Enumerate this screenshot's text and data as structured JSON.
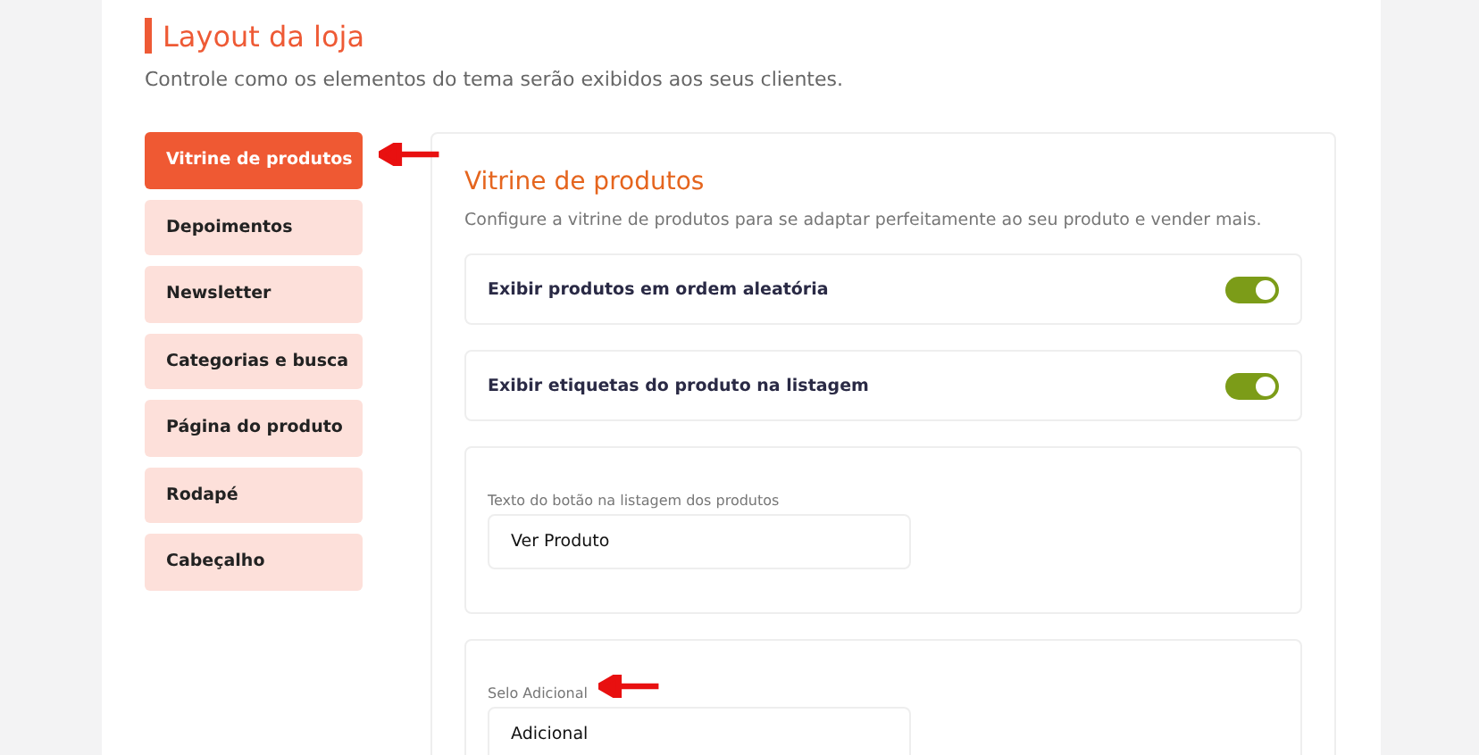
{
  "header": {
    "title": "Layout da loja",
    "subtitle": "Controle como os elementos do tema serão exibidos aos seus clientes."
  },
  "sidebar": {
    "items": [
      {
        "label": "Vitrine de produtos",
        "selected": true
      },
      {
        "label": "Depoimentos",
        "selected": false
      },
      {
        "label": "Newsletter",
        "selected": false
      },
      {
        "label": "Categorias e busca",
        "selected": false
      },
      {
        "label": "Página do produto",
        "selected": false
      },
      {
        "label": "Rodapé",
        "selected": false
      },
      {
        "label": "Cabeçalho",
        "selected": false
      }
    ]
  },
  "panel": {
    "title": "Vitrine de produtos",
    "description": "Configure a vitrine de produtos para se adaptar perfeitamente ao seu produto e vender mais.",
    "settings": [
      {
        "kind": "toggle",
        "label": "Exibir produtos em ordem aleatória",
        "on": true
      },
      {
        "kind": "toggle",
        "label": "Exibir etiquetas do produto na listagem",
        "on": true
      },
      {
        "kind": "text",
        "label": "Texto do botão na listagem dos produtos",
        "value": "Ver Produto"
      },
      {
        "kind": "text",
        "label": "Selo Adicional",
        "value": "Adicional"
      }
    ]
  }
}
